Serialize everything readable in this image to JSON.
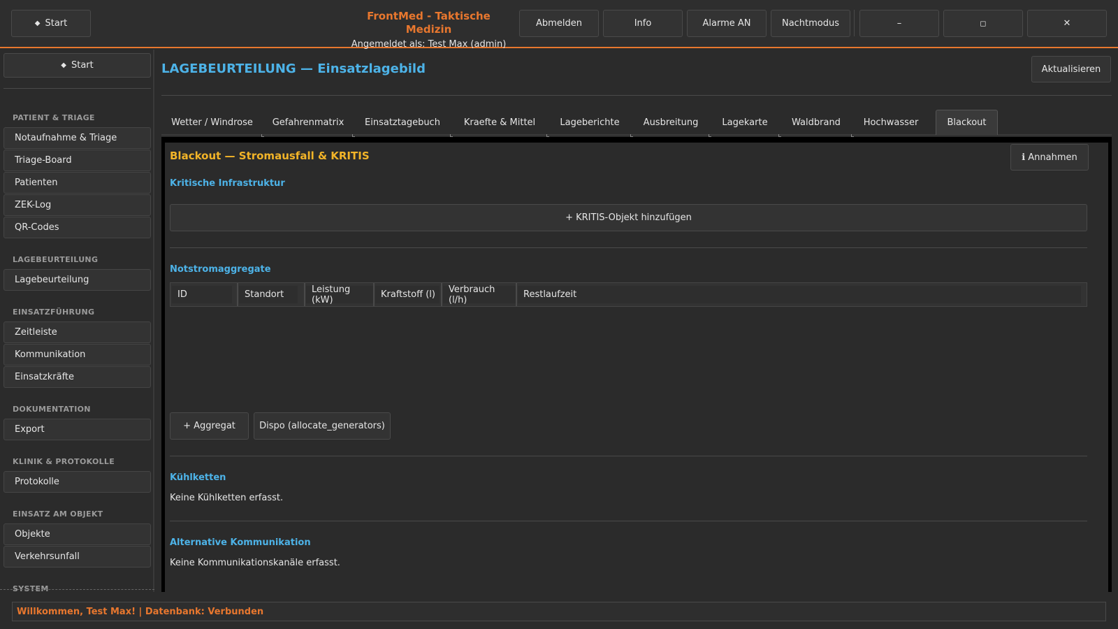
{
  "topbar": {
    "start_label": "Start",
    "app_title": "FrontMed - Taktische Medizin",
    "logged_in": "Angemeldet als: Test Max (admin)",
    "buttons": [
      "Abmelden",
      "Info",
      "Alarme AN",
      "Nachtmodus"
    ],
    "minimize": "–",
    "maximize": "◻",
    "close": "✕"
  },
  "sidebar": {
    "start_label": "Start",
    "sections": [
      {
        "heading": "PATIENT & TRIAGE",
        "items": [
          "Notaufnahme & Triage",
          "Triage-Board",
          "Patienten",
          "ZEK-Log",
          "QR-Codes"
        ]
      },
      {
        "heading": "LAGEBEURTEILUNG",
        "items": [
          "Lagebeurteilung"
        ]
      },
      {
        "heading": "EINSATZFÜHRUNG",
        "items": [
          "Zeitleiste",
          "Kommunikation",
          "Einsatzkräfte"
        ]
      },
      {
        "heading": "DOKUMENTATION",
        "items": [
          "Export"
        ]
      },
      {
        "heading": "KLINIK & PROTOKOLLE",
        "items": [
          "Protokolle"
        ]
      },
      {
        "heading": "EINSATZ AM OBJEKT",
        "items": [
          "Objekte",
          "Verkehrsunfall"
        ]
      },
      {
        "heading": "SYSTEM",
        "items": []
      }
    ]
  },
  "main": {
    "page_title": "LAGEBEURTEILUNG — Einsatzlagebild",
    "refresh_label": "Aktualisieren",
    "tabs": [
      "Wetter / Windrose",
      "Gefahrenmatrix",
      "Einsatztagebuch",
      "Kraefte & Mittel",
      "Lageberichte",
      "Ausbreitung",
      "Lagekarte",
      "Waldbrand",
      "Hochwasser",
      "Blackout"
    ],
    "active_tab": "Blackout"
  },
  "panel": {
    "title": "Blackout — Stromausfall & KRITIS",
    "info_label": "ℹ Annahmen",
    "kritis_heading": "Kritische Infrastruktur",
    "add_kritis_label": "+ KRITIS-Objekt hinzufügen",
    "generators_heading": "Notstromaggregate",
    "columns": [
      "ID",
      "Standort",
      "Leistung (kW)",
      "Kraftstoff (l)",
      "Verbrauch (l/h)",
      "Restlaufzeit"
    ],
    "add_aggregate_label": "+ Aggregat",
    "dispo_label": "Dispo (allocate_generators)",
    "coldchain_heading": "Kühlketten",
    "coldchain_empty": "Keine Kühlketten erfasst.",
    "altcomm_heading": "Alternative Kommunikation",
    "altcomm_empty": "Keine Kommunikationskanäle erfasst."
  },
  "status": {
    "message": "Willkommen, Test Max! | Datenbank: Verbunden"
  },
  "colors": {
    "accent_orange": "#e8772e",
    "heading_blue": "#4db3e8",
    "panel_title_yellow": "#f2b428"
  }
}
